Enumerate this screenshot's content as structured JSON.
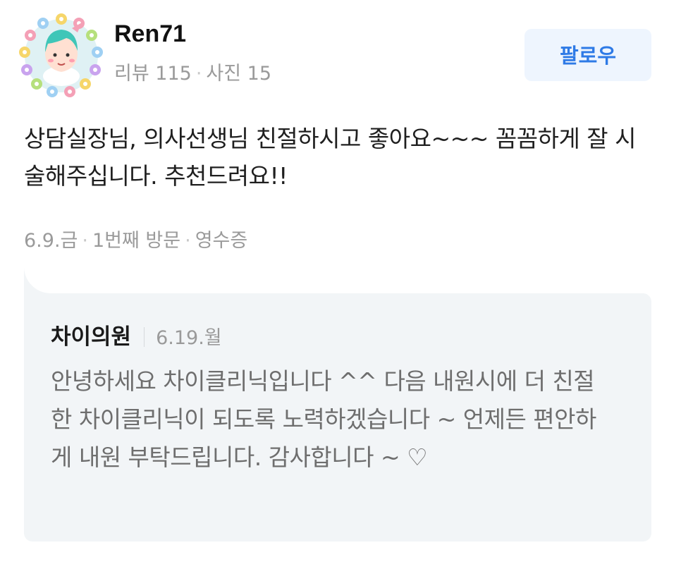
{
  "author": {
    "name": "Ren71",
    "reviews_label": "리뷰 115",
    "photos_label": "사진 15",
    "stats_separator": "·"
  },
  "follow_button": {
    "label": "팔로우"
  },
  "review": {
    "text": "상담실장님, 의사선생님 친절하시고 좋아요~~~ 꼼꼼하게 잘 시술해주십니다. 추천드려요!!",
    "date": "6.9.금",
    "visit": "1번째 방문",
    "verification": "영수증",
    "meta_separator": "·"
  },
  "reply": {
    "author": "차이의원",
    "date": "6.19.월",
    "text": "안녕하세요 차이클리닉입니다 ^^ 다음 내원시에 더 친절한 차이클리닉이 되도록 노력하겠습니다 ~ 언제든 편안하게 내원 부탁드립니다. 감사합니다 ~ ♡"
  },
  "colors": {
    "follow_button_bg": "#eef5fe",
    "follow_button_text": "#2e7ae6",
    "reply_box_bg": "#f2f5f7",
    "muted_text": "#9a9a9a"
  },
  "icons": {
    "avatar": "profile-avatar-flower-wreath"
  }
}
